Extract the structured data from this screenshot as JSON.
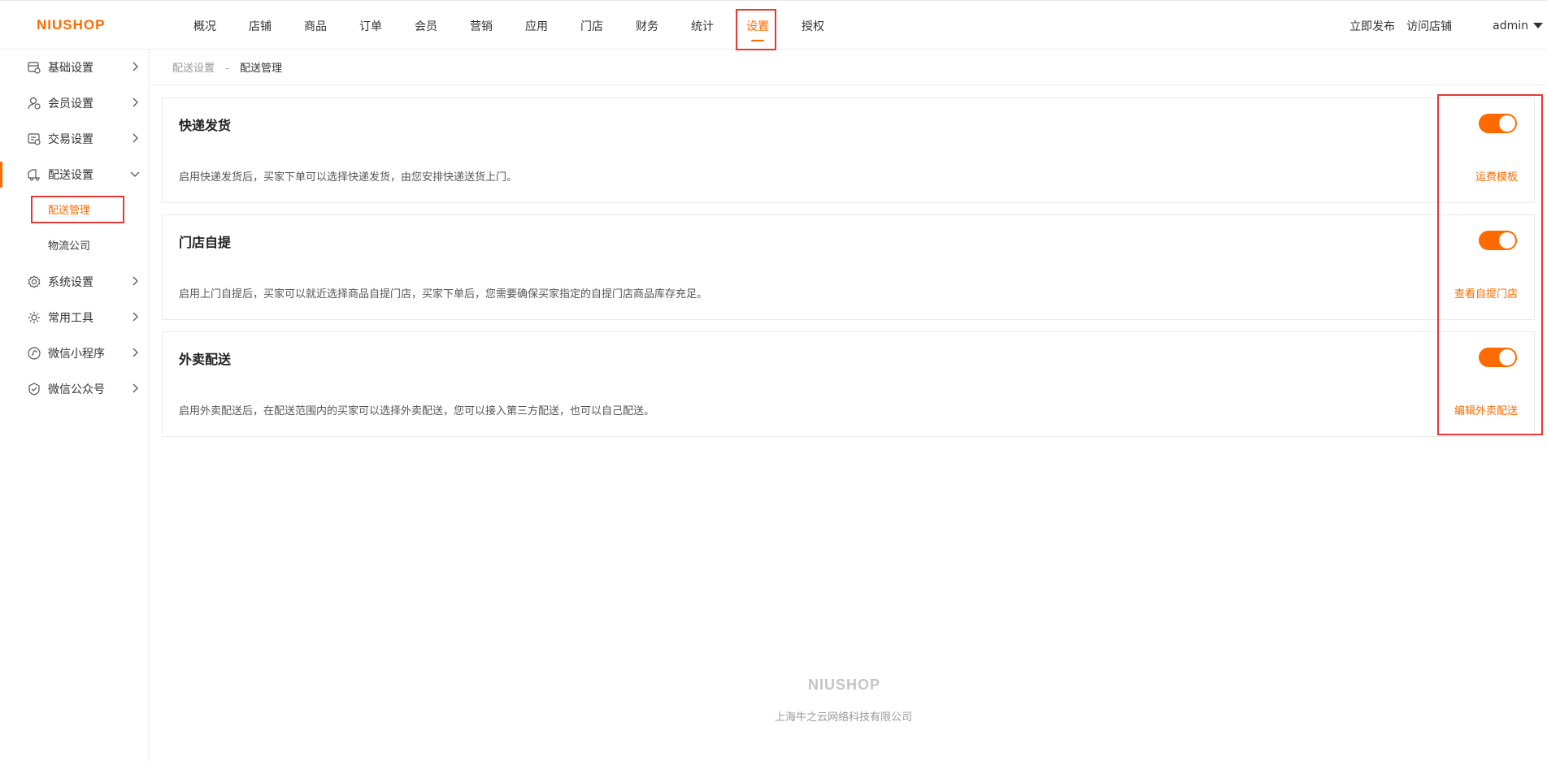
{
  "header": {
    "logo": "NIUSHOP",
    "nav": [
      "概况",
      "店铺",
      "商品",
      "订单",
      "会员",
      "营销",
      "应用",
      "门店",
      "财务",
      "统计",
      "设置",
      "授权"
    ],
    "active_nav": "设置",
    "publish": "立即发布",
    "visit_store": "访问店铺",
    "user": "admin"
  },
  "sidebar": {
    "items": [
      {
        "label": "基础设置",
        "icon": "store-settings-icon"
      },
      {
        "label": "会员设置",
        "icon": "member-settings-icon"
      },
      {
        "label": "交易设置",
        "icon": "trade-settings-icon"
      },
      {
        "label": "配送设置",
        "icon": "delivery-truck-icon"
      },
      {
        "label": "系统设置",
        "icon": "gear-icon"
      },
      {
        "label": "常用工具",
        "icon": "tools-icon"
      },
      {
        "label": "微信小程序",
        "icon": "mini-program-icon"
      },
      {
        "label": "微信公众号",
        "icon": "wechat-official-icon"
      }
    ],
    "sub_items": [
      "配送管理",
      "物流公司"
    ]
  },
  "breadcrumb": {
    "parent": "配送设置",
    "separator": "-",
    "current": "配送管理"
  },
  "cards": [
    {
      "title": "快递发货",
      "desc": "启用快递发货后，买家下单可以选择快递发货，由您安排快递送货上门。",
      "link": "运费模板",
      "enabled": true
    },
    {
      "title": "门店自提",
      "desc": "启用上门自提后，买家可以就近选择商品自提门店，买家下单后，您需要确保买家指定的自提门店商品库存充足。",
      "link": "查看自提门店",
      "enabled": true
    },
    {
      "title": "外卖配送",
      "desc": "启用外卖配送后，在配送范围内的买家可以选择外卖配送，您可以接入第三方配送，也可以自己配送。",
      "link": "编辑外卖配送",
      "enabled": true
    }
  ],
  "footer": {
    "logo": "NIUSHOP",
    "company": "上海牛之云网络科技有限公司"
  },
  "colors": {
    "accent": "#ff6a00",
    "highlight": "#e53935"
  }
}
